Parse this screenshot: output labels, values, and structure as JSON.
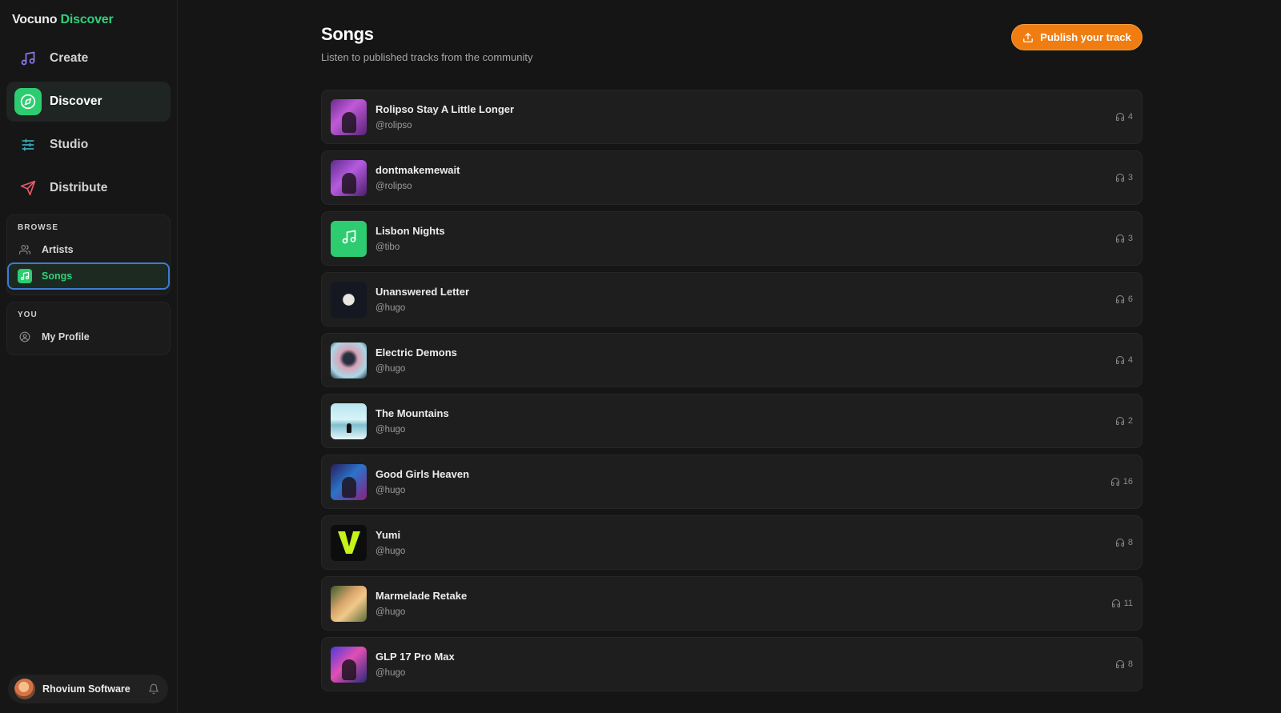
{
  "brand": {
    "name": "Vocuno",
    "accent": "Discover",
    "accent_color": "#2fd17a"
  },
  "nav": [
    {
      "label": "Create",
      "icon": "music-note-icon",
      "active": false
    },
    {
      "label": "Discover",
      "icon": "compass-icon",
      "active": true
    },
    {
      "label": "Studio",
      "icon": "sliders-icon",
      "active": false
    },
    {
      "label": "Distribute",
      "icon": "send-icon",
      "active": false
    }
  ],
  "browse": {
    "title": "BROWSE",
    "items": [
      {
        "label": "Artists",
        "icon": "users-icon",
        "active": false
      },
      {
        "label": "Songs",
        "icon": "music-note-icon",
        "active": true
      }
    ]
  },
  "you": {
    "title": "YOU",
    "items": [
      {
        "label": "My Profile",
        "icon": "user-circle-icon",
        "active": false
      }
    ]
  },
  "user": {
    "name": "Rhovium Software",
    "bell_icon": "bell-icon"
  },
  "page": {
    "title": "Songs",
    "subtitle": "Listen to published tracks from the community",
    "publish_label": "Publish your track",
    "publish_color": "#f07d12"
  },
  "songs": [
    {
      "title": "Rolipso Stay A Little Longer",
      "artist": "@rolipso",
      "plays": "4"
    },
    {
      "title": "dontmakemewait",
      "artist": "@rolipso",
      "plays": "3"
    },
    {
      "title": "Lisbon Nights",
      "artist": "@tibo",
      "plays": "3"
    },
    {
      "title": "Unanswered Letter",
      "artist": "@hugo",
      "plays": "6"
    },
    {
      "title": "Electric Demons",
      "artist": "@hugo",
      "plays": "4"
    },
    {
      "title": "The Mountains",
      "artist": "@hugo",
      "plays": "2"
    },
    {
      "title": "Good Girls Heaven",
      "artist": "@hugo",
      "plays": "16"
    },
    {
      "title": "Yumi",
      "artist": "@hugo",
      "plays": "8"
    },
    {
      "title": "Marmelade Retake",
      "artist": "@hugo",
      "plays": "11"
    },
    {
      "title": "GLP 17 Pro Max",
      "artist": "@hugo",
      "plays": "8"
    }
  ]
}
